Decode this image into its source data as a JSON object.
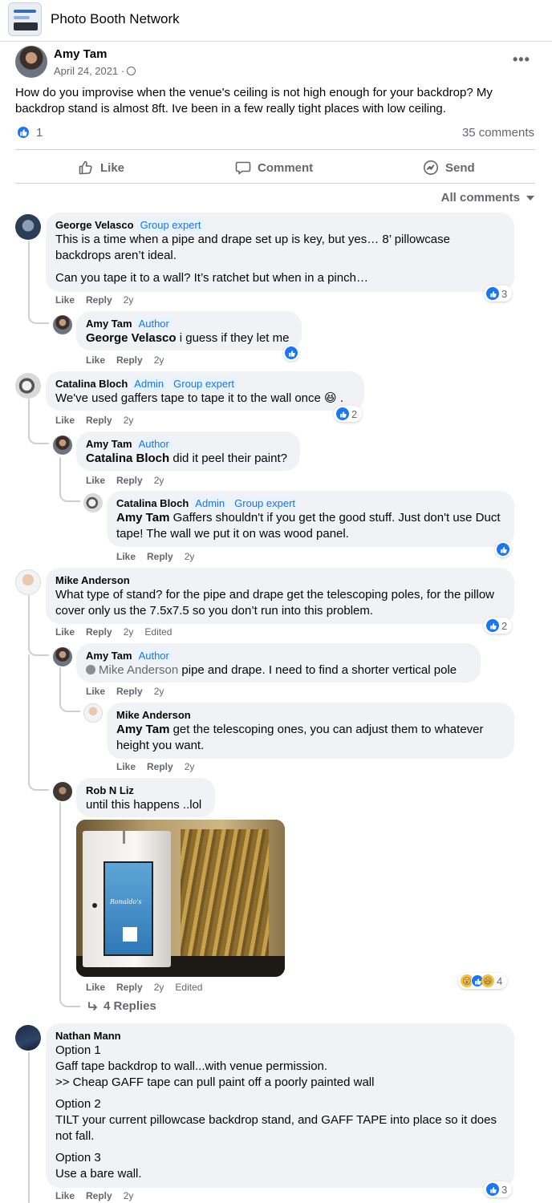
{
  "group": {
    "name": "Photo Booth Network"
  },
  "post": {
    "author": "Amy Tam",
    "date": "April 24, 2021 ·",
    "more": "•••",
    "text": "How do you improvise when the venue's ceiling is not high enough for your backdrop?  My backdrop stand is almost 8ft.  Ive been in a few really tight places with low ceiling.",
    "reaction_count": "1",
    "comments_count": "35 comments"
  },
  "actions": {
    "like": "Like",
    "comment": "Comment",
    "send": "Send"
  },
  "sort_label": "All comments",
  "colors": {
    "accent": "#1877f2",
    "bubble": "#f0f2f5",
    "meta": "#65676b"
  },
  "comments": [
    {
      "name": "George Velasco",
      "tags": [
        "Group expert"
      ],
      "paragraphs": [
        "This is a time when a pipe and drape set up is key, but yes… 8’ pillowcase backdrops aren’t ideal.",
        "Can you tape it to a wall? It’s ratchet but when in a pinch…"
      ],
      "like": "Like",
      "reply": "Reply",
      "time": "2y",
      "reactions": "3"
    },
    {
      "name": "Amy Tam",
      "tags": [
        "Author"
      ],
      "mention": "George Velasco",
      "text": " i guess if they let me",
      "like": "Like",
      "reply": "Reply",
      "time": "2y"
    },
    {
      "name": "Catalina Bloch",
      "tags": [
        "Admin",
        "Group expert"
      ],
      "text": "We've used gaffers tape to tape it to the wall once 😆 .",
      "like": "Like",
      "reply": "Reply",
      "time": "2y",
      "reactions": "2"
    },
    {
      "name": "Amy Tam",
      "tags": [
        "Author"
      ],
      "mention": "Catalina Bloch",
      "text": " did it peel their paint?",
      "like": "Like",
      "reply": "Reply",
      "time": "2y"
    },
    {
      "name": "Catalina Bloch",
      "tags": [
        "Admin",
        "Group expert"
      ],
      "mention": "Amy Tam",
      "text": " Gaffers shouldn't if you get the good stuff. Just don't use Duct tape! The wall we put it on was wood panel.",
      "like": "Like",
      "reply": "Reply",
      "time": "2y"
    },
    {
      "name": "Mike Anderson",
      "text": "What type of stand? for the pipe and drape get the telescoping poles, for the pillow cover only us the 7.5x7.5 so you don’t run into this problem.",
      "like": "Like",
      "reply": "Reply",
      "time": "2y",
      "edited": "Edited",
      "reactions": "2"
    },
    {
      "name": "Amy Tam",
      "tags": [
        "Author"
      ],
      "mention": "Mike Anderson",
      "text": " pipe and drape. I need to find a shorter vertical pole",
      "like": "Like",
      "reply": "Reply",
      "time": "2y"
    },
    {
      "name": "Mike Anderson",
      "mention": "Amy Tam",
      "text": " get the telescoping ones, you can adjust them to whatever height you want.",
      "like": "Like",
      "reply": "Reply",
      "time": "2y"
    },
    {
      "name": "Rob N Liz",
      "text": "until this happens ..lol",
      "like": "Like",
      "reply": "Reply",
      "time": "2y",
      "edited": "Edited",
      "reactions": "4",
      "replies_link": "4 Replies"
    },
    {
      "name": "Nathan Mann",
      "paragraphs": [
        "Option 1\nGaff tape backdrop to wall...with venue permission.\n>> Cheap GAFF tape can pull paint off a poorly painted wall",
        "Option 2\nTILT your current pillowcase backdrop stand, and GAFF TAPE into place so it does not fall.",
        "Option 3\nUse a bare wall."
      ],
      "like": "Like",
      "reply": "Reply",
      "time": "2y",
      "reactions": "3"
    }
  ],
  "photo_booth_text": "Ronaldo's"
}
